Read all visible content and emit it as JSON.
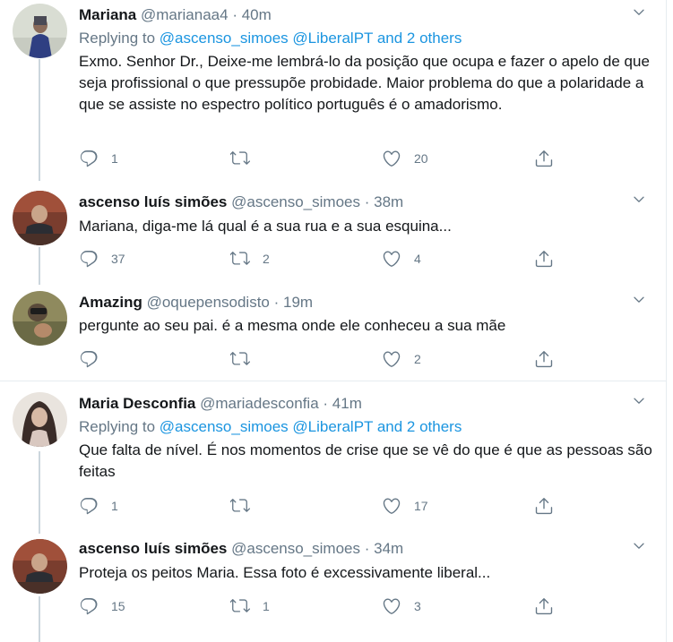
{
  "colors": {
    "link": "#1b95e0",
    "muted": "#657786",
    "text": "#14171a",
    "divider": "#e6ecf0"
  },
  "icons": [
    "reply-icon",
    "retweet-icon",
    "like-icon",
    "share-icon",
    "chevron-down-icon"
  ],
  "tweets": [
    {
      "name": "Mariana",
      "handle": "@marianaa4",
      "time": "· 40m",
      "reply_prefix": "Replying to",
      "reply_targets": "@ascenso_simoes @LiberalPT and 2 others",
      "text": "Exmo. Senhor Dr., Deixe-me lembrá-lo da posição que ocupa e fazer o apelo de que seja profissional o que pressupõe probidade. Maior problema do que a polaridade a que se assiste no espectro político português é o amadorismo.",
      "replies": "1",
      "retweets": "",
      "likes": "20"
    },
    {
      "name": "ascenso luís simões",
      "handle": "@ascenso_simoes",
      "time": "· 38m",
      "text": "Mariana, diga-me lá qual é a sua rua e a sua esquina...",
      "replies": "37",
      "retweets": "2",
      "likes": "4"
    },
    {
      "name": "Amazing",
      "handle": "@oquepensodisto",
      "time": "· 19m",
      "text": "pergunte ao seu pai. é a mesma onde ele conheceu a sua mãe",
      "replies": "",
      "retweets": "",
      "likes": "2"
    },
    {
      "name": "Maria Desconfia",
      "handle": "@mariadesconfia",
      "time": "· 41m",
      "reply_prefix": "Replying to",
      "reply_targets": "@ascenso_simoes @LiberalPT and 2 others",
      "text": "Que falta de nível. É nos momentos de crise que se vê do que é que as pessoas são feitas",
      "replies": "1",
      "retweets": "",
      "likes": "17"
    },
    {
      "name": "ascenso luís simões",
      "handle": "@ascenso_simoes",
      "time": "· 34m",
      "text": "Proteja os peitos Maria. Essa foto é excessivamente liberal...",
      "replies": "15",
      "retweets": "1",
      "likes": "3"
    }
  ]
}
